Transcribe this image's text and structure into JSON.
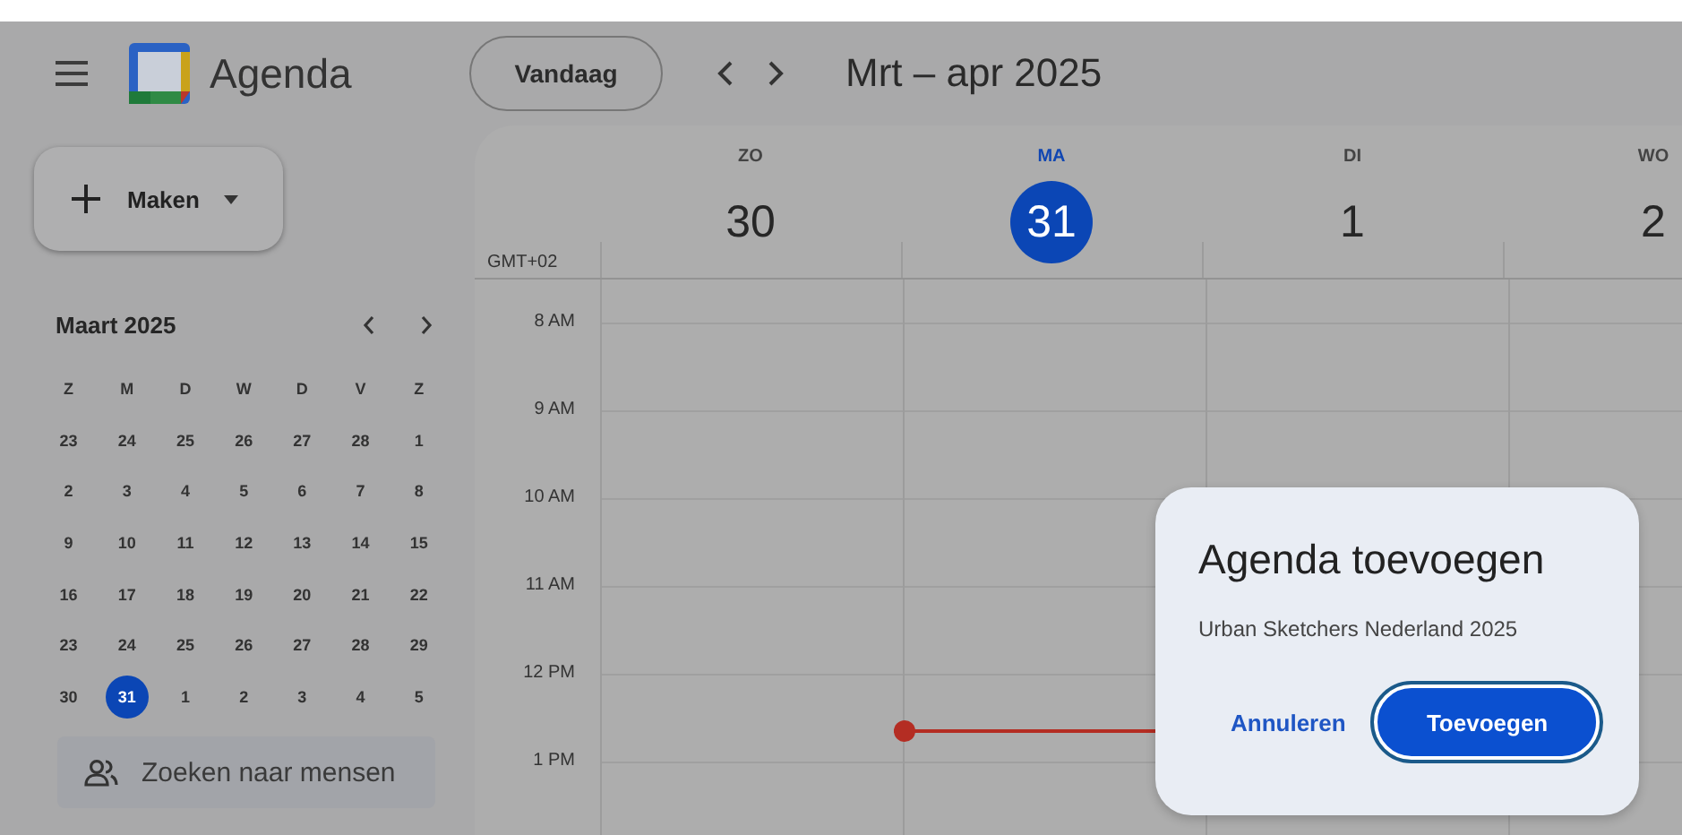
{
  "header": {
    "app_name": "Agenda",
    "today_button": "Vandaag",
    "range_title": "Mrt – apr 2025"
  },
  "sidebar": {
    "create_button": "Maken",
    "mini_calendar": {
      "title": "Maart 2025",
      "weekdays": [
        "Z",
        "M",
        "D",
        "W",
        "D",
        "V",
        "Z"
      ],
      "weeks": [
        [
          {
            "day": "23",
            "selected": false
          },
          {
            "day": "24",
            "selected": false
          },
          {
            "day": "25",
            "selected": false
          },
          {
            "day": "26",
            "selected": false
          },
          {
            "day": "27",
            "selected": false
          },
          {
            "day": "28",
            "selected": false
          },
          {
            "day": "1",
            "selected": false
          }
        ],
        [
          {
            "day": "2",
            "selected": false
          },
          {
            "day": "3",
            "selected": false
          },
          {
            "day": "4",
            "selected": false
          },
          {
            "day": "5",
            "selected": false
          },
          {
            "day": "6",
            "selected": false
          },
          {
            "day": "7",
            "selected": false
          },
          {
            "day": "8",
            "selected": false
          }
        ],
        [
          {
            "day": "9",
            "selected": false
          },
          {
            "day": "10",
            "selected": false
          },
          {
            "day": "11",
            "selected": false
          },
          {
            "day": "12",
            "selected": false
          },
          {
            "day": "13",
            "selected": false
          },
          {
            "day": "14",
            "selected": false
          },
          {
            "day": "15",
            "selected": false
          }
        ],
        [
          {
            "day": "16",
            "selected": false
          },
          {
            "day": "17",
            "selected": false
          },
          {
            "day": "18",
            "selected": false
          },
          {
            "day": "19",
            "selected": false
          },
          {
            "day": "20",
            "selected": false
          },
          {
            "day": "21",
            "selected": false
          },
          {
            "day": "22",
            "selected": false
          }
        ],
        [
          {
            "day": "23",
            "selected": false
          },
          {
            "day": "24",
            "selected": false
          },
          {
            "day": "25",
            "selected": false
          },
          {
            "day": "26",
            "selected": false
          },
          {
            "day": "27",
            "selected": false
          },
          {
            "day": "28",
            "selected": false
          },
          {
            "day": "29",
            "selected": false
          }
        ],
        [
          {
            "day": "30",
            "selected": false
          },
          {
            "day": "31",
            "selected": true
          },
          {
            "day": "1",
            "selected": false
          },
          {
            "day": "2",
            "selected": false
          },
          {
            "day": "3",
            "selected": false
          },
          {
            "day": "4",
            "selected": false
          },
          {
            "day": "5",
            "selected": false
          }
        ]
      ]
    },
    "people_search": {
      "placeholder": "Zoeken naar mensen"
    }
  },
  "week": {
    "timezone": "GMT+02",
    "days": [
      {
        "weekday": "ZO",
        "date": "30",
        "selected": false
      },
      {
        "weekday": "MA",
        "date": "31",
        "selected": true
      },
      {
        "weekday": "DI",
        "date": "1",
        "selected": false
      },
      {
        "weekday": "WO",
        "date": "2",
        "selected": false
      }
    ],
    "hours": [
      "8 AM",
      "9 AM",
      "10 AM",
      "11 AM",
      "12 PM",
      "1 PM"
    ]
  },
  "dialog": {
    "title": "Agenda toevoegen",
    "message": "Urban Sketchers Nederland 2025",
    "cancel_button": "Annuleren",
    "confirm_button": "Toevoegen"
  }
}
